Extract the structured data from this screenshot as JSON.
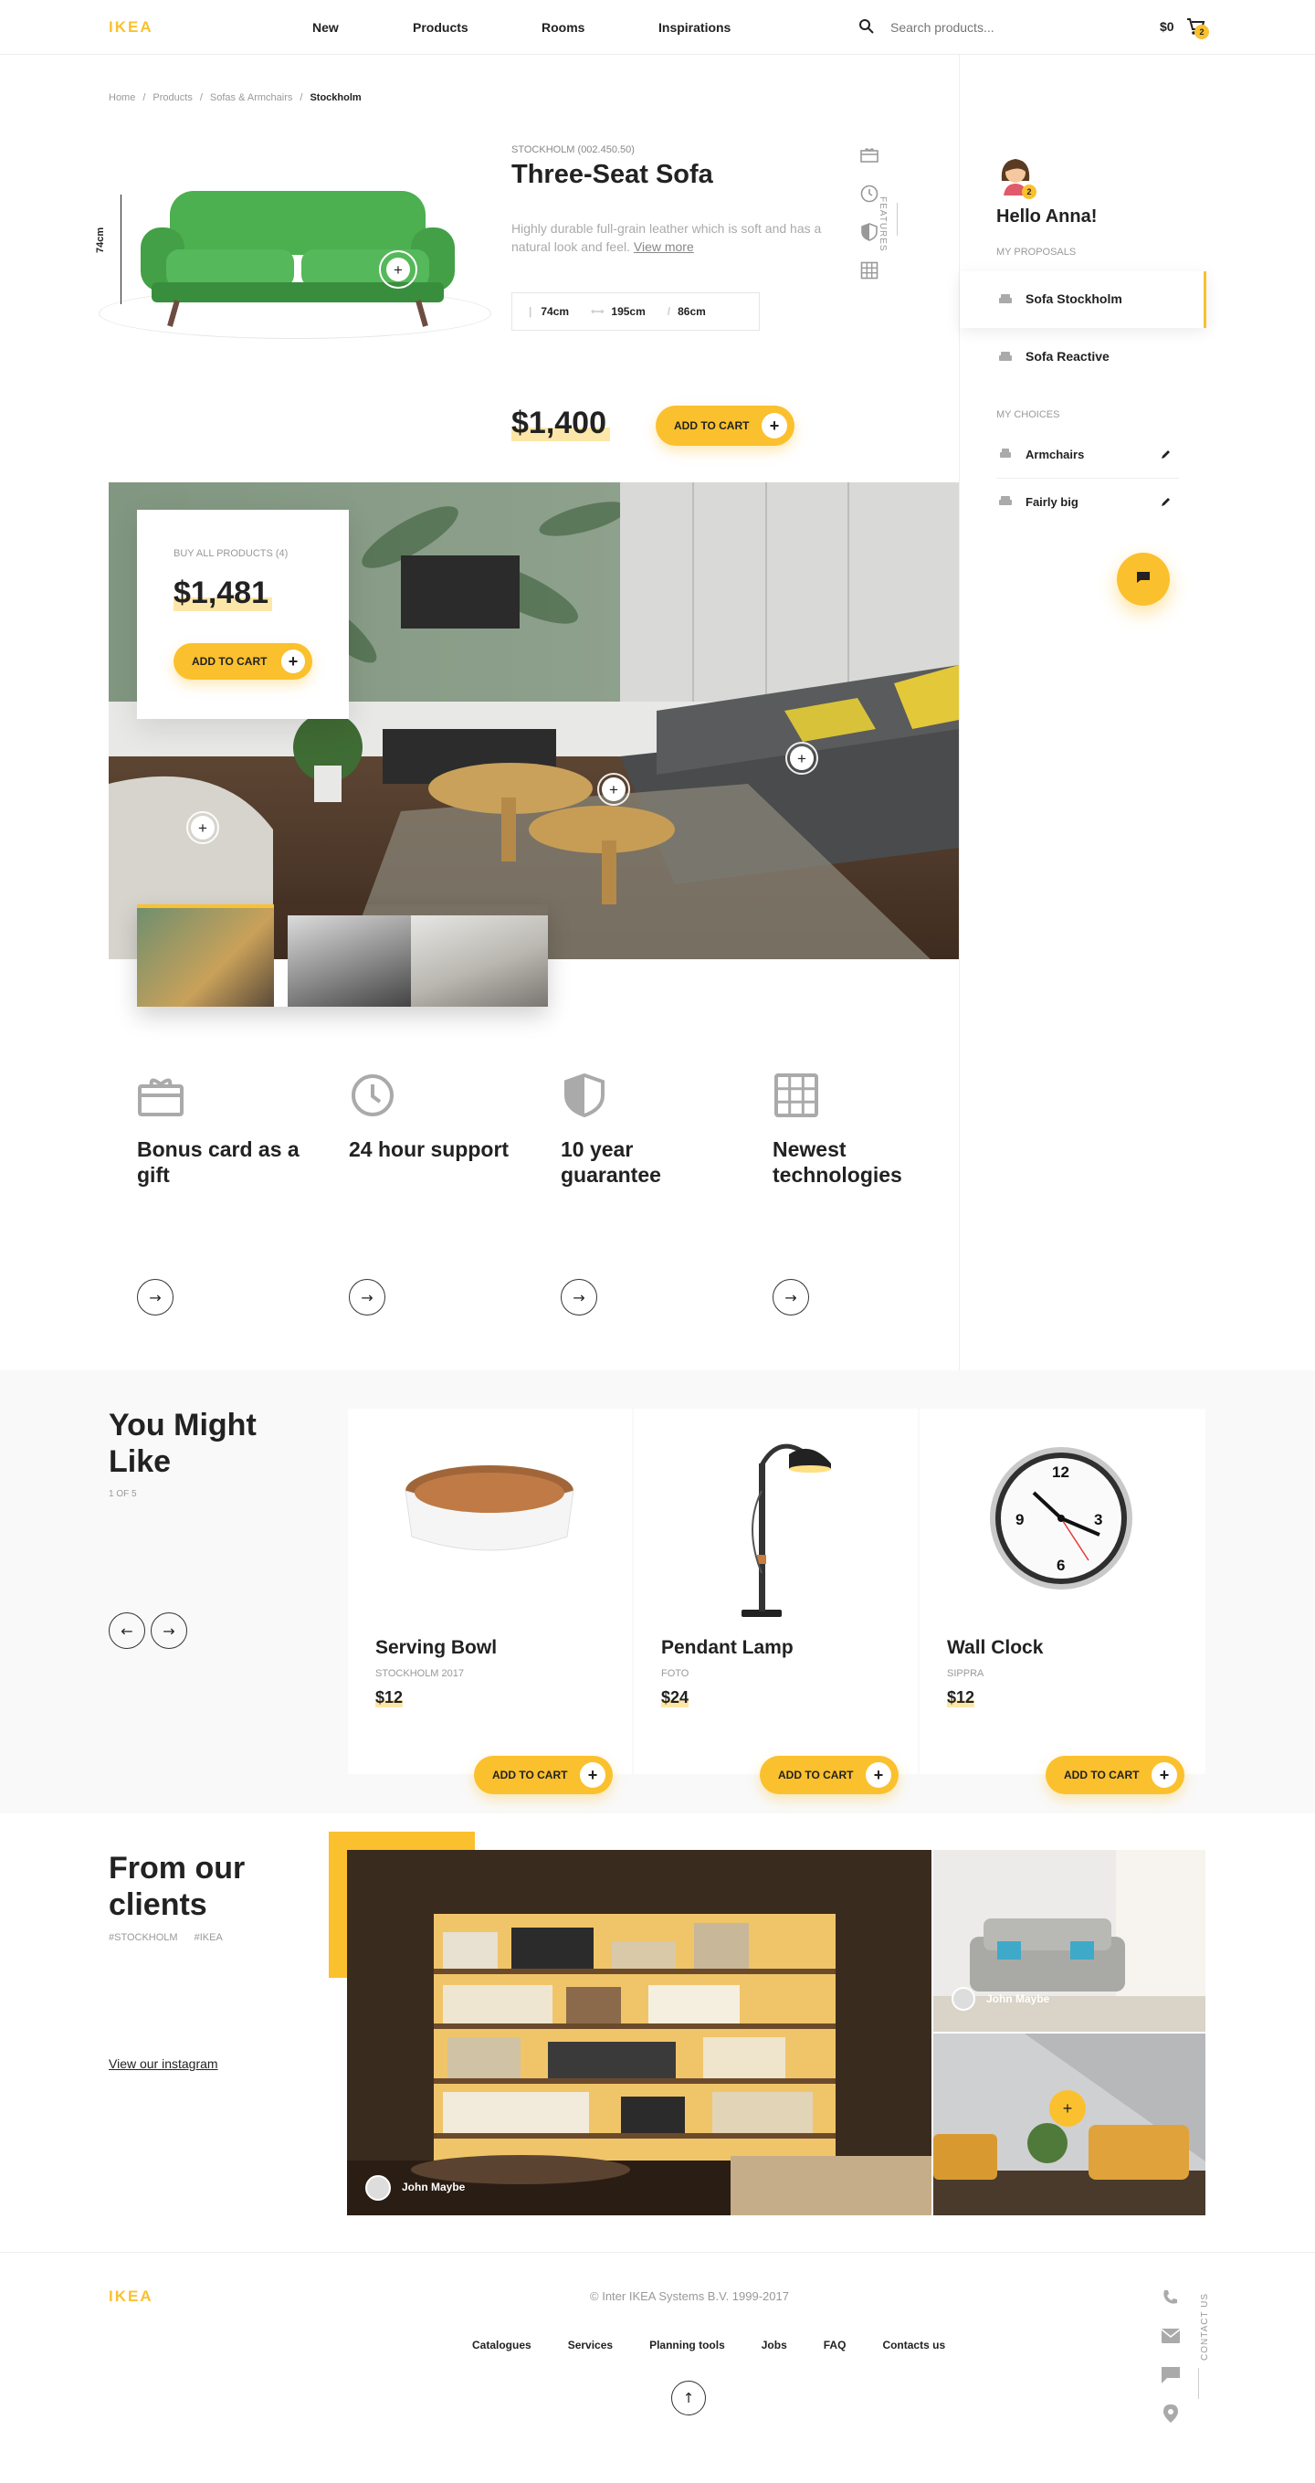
{
  "header": {
    "logo": "IKEA",
    "nav": [
      "New",
      "Products",
      "Rooms",
      "Inspirations"
    ],
    "search_placeholder": "Search products...",
    "cart_total": "$0",
    "cart_count": "2"
  },
  "breadcrumb": [
    "Home",
    "Products",
    "Sofas & Armchairs",
    "Stockholm"
  ],
  "product": {
    "sku": "STOCKHOLM (002.450.50)",
    "title": "Three-Seat Sofa",
    "description": "Highly durable full-grain leather which is soft and has a natural look and feel.",
    "view_more": "View more",
    "height_label": "74cm",
    "dims": [
      "74cm",
      "195cm",
      "86cm"
    ],
    "price": "$1,400",
    "add_to_cart": "ADD TO CART",
    "features_label": "FEATURES"
  },
  "sidebar": {
    "avatar_badge": "2",
    "greeting": "Hello Anna!",
    "proposals_title": "MY PROPOSALS",
    "proposals": [
      "Sofa Stockholm",
      "Sofa Reactive"
    ],
    "choices_title": "MY CHOICES",
    "choices": [
      "Armchairs",
      "Fairly big"
    ]
  },
  "room": {
    "buy_all_label": "BUY ALL PRODUCTS (4)",
    "price": "$1,481",
    "add_to_cart": "ADD TO CART"
  },
  "features": [
    {
      "icon": "gift-card-icon",
      "title": "Bonus card as a gift"
    },
    {
      "icon": "clock-icon",
      "title": "24 hour support"
    },
    {
      "icon": "shield-icon",
      "title": "10 year guarantee"
    },
    {
      "icon": "grid-icon",
      "title": "Newest technologies"
    }
  ],
  "recommendations": {
    "title": "You Might Like",
    "pager": "1 OF 5",
    "items": [
      {
        "name": "Serving Bowl",
        "collection": "STOCKHOLM 2017",
        "price": "$12",
        "button": "ADD TO CART"
      },
      {
        "name": "Pendant Lamp",
        "collection": "FOTO",
        "price": "$24",
        "button": "ADD TO CART"
      },
      {
        "name": "Wall Clock",
        "collection": "SIPPRA",
        "price": "$12",
        "button": "ADD TO CART"
      }
    ]
  },
  "clients": {
    "title": "From our clients",
    "tags": [
      "#STOCKHOLM",
      "#IKEA"
    ],
    "link": "View our instagram",
    "author_main": "John Maybe",
    "author_top": "John Maybe"
  },
  "footer": {
    "logo": "IKEA",
    "copyright": "© Inter IKEA Systems B.V. 1999-2017",
    "links": [
      "Catalogues",
      "Services",
      "Planning tools",
      "Jobs",
      "FAQ",
      "Contacts us"
    ],
    "contact_label": "CONTACT US"
  },
  "colors": {
    "accent": "#fbc02d",
    "accent_light": "#fde7a8",
    "text": "#222222",
    "muted": "#999999"
  }
}
